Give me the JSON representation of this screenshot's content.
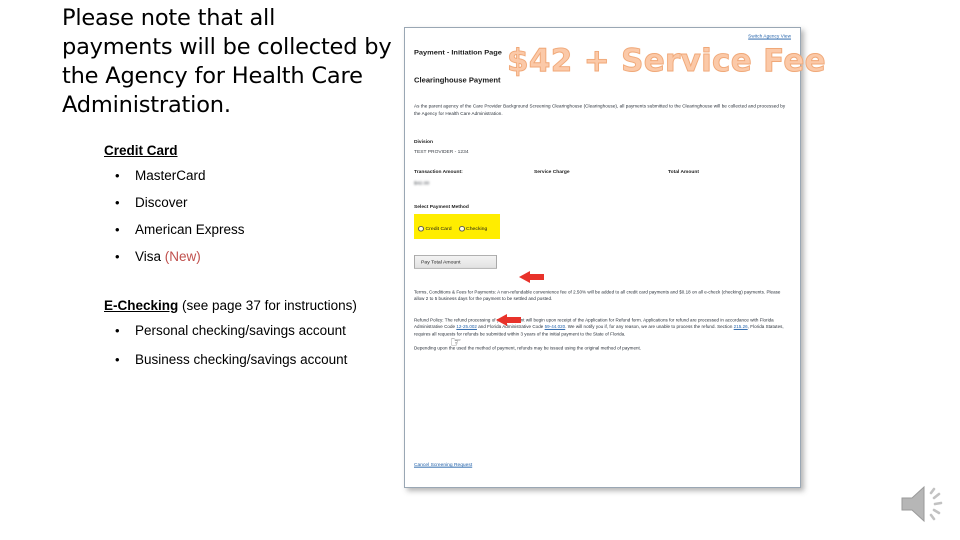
{
  "slide": {
    "heading": "Please note that all payments will be collected by the Agency for Health Care Administration.",
    "credit_card": {
      "title_strong": "Credit Card",
      "items": [
        {
          "label": "MasterCard",
          "note": ""
        },
        {
          "label": "Discover",
          "note": ""
        },
        {
          "label": "American Express",
          "note": ""
        },
        {
          "label": "Visa ",
          "note": "(New)"
        }
      ]
    },
    "echecking": {
      "title_strong": "E-Checking",
      "title_rest": " (see page 37 for instructions)",
      "items": [
        {
          "label": "Personal checking/savings account"
        },
        {
          "label": "Business checking/savings account"
        }
      ]
    },
    "bullet_glyph": "•"
  },
  "screenshot": {
    "switch_view_link": "Switch Agency View",
    "title": "Payment - Initiation Page",
    "subtitle": "Clearinghouse Payment",
    "intro": "As the parent agency of the Care Provider Background Screening Clearinghouse (Clearinghouse), all payments submitted to the Clearinghouse will be collected and processed by the Agency for Health Care Administration.",
    "division_label": "Division",
    "division_value": "TEST PROVIDER - 1234",
    "transaction_amount_label": "Transaction Amount:",
    "transaction_amount_value": "$42.00",
    "service_charge_label": "Service Charge",
    "total_amount_label": "Total Amount",
    "select_payment_label": "Select Payment Method",
    "radio_credit_card": "Credit Card",
    "radio_checking": "Checking",
    "pay_button_label": "Pay Total Amount",
    "terms_text": "Terms, Conditions & Fees for Payments: A non-refundable convenience fee of 2.50% will be added to all credit card payments and $0.18 on all e-check (checking) payments. Please allow 2 to 5 business days for the payment to be settled and posted.",
    "refund_text_1": "Refund Policy: The refund processing of your payment will begin upon receipt of the Application for Refund form. Applications for refund are processed in accordance with Florida Administrative Code ",
    "refund_link_1": "12-25.002",
    "refund_text_2": " and Florida Administrative Code ",
    "refund_link_2": "59-44.020",
    "refund_text_3": ". We will notify you if, for any reason, we are unable to process the refund. Section ",
    "refund_link_3": "215.26",
    "refund_text_4": ", Florida Statutes, requires all requests for refunds be submitted within 3 years of the initial payment to the State of Florida.",
    "refund_text_5": "Depending upon the used the method of payment, refunds may be issued using the original method of payment.",
    "cancel_link": "Cancel Screening Request",
    "price_overlay": "$42 + Service Fee",
    "highlight_color": "#ffed00",
    "arrow_color": "#e8322a",
    "link_color": "#1f5fa8",
    "overlay_color": "#fbc9a8"
  },
  "media": {
    "speaker_icon_name": "speaker-audio-icon"
  }
}
